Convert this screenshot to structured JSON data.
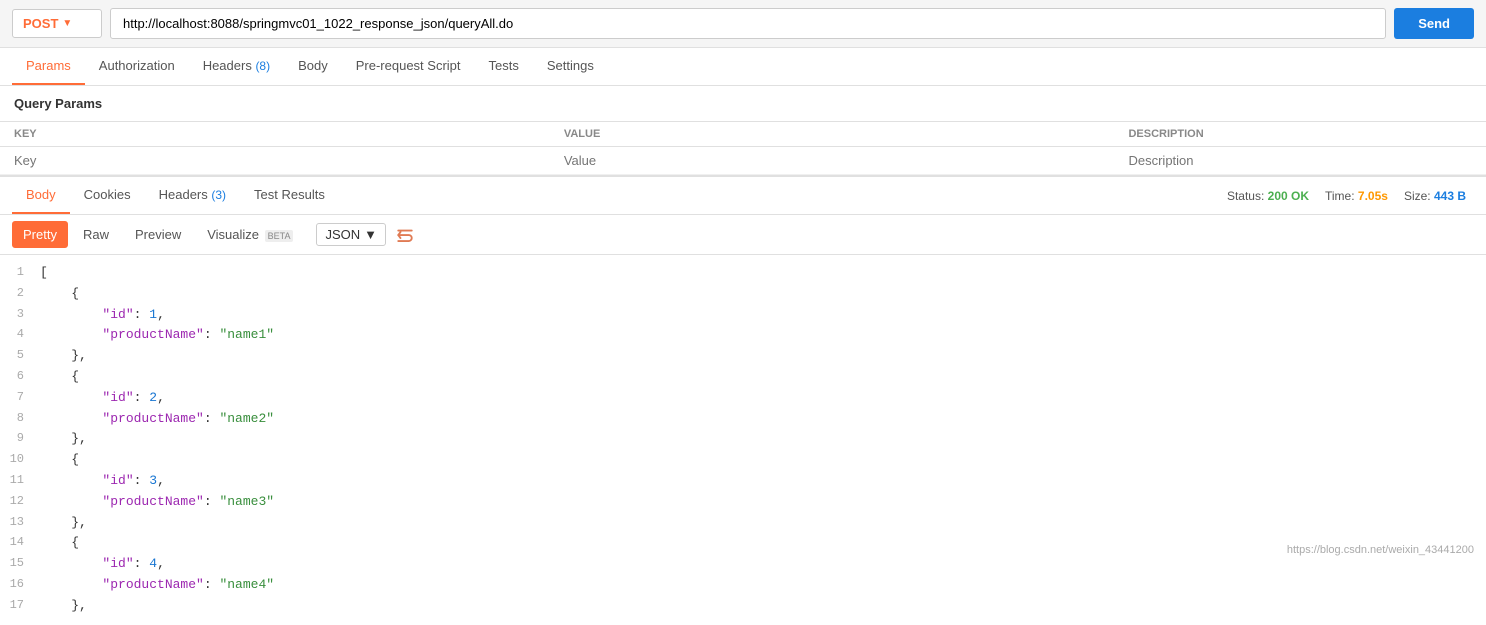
{
  "urlBar": {
    "method": "POST",
    "url": "http://localhost:8088/springmvc01_1022_response_json/queryAll.do",
    "sendLabel": "Send"
  },
  "requestTabs": [
    {
      "id": "params",
      "label": "Params",
      "badge": null,
      "active": true
    },
    {
      "id": "authorization",
      "label": "Authorization",
      "badge": null,
      "active": false
    },
    {
      "id": "headers",
      "label": "Headers",
      "badge": "8",
      "active": false
    },
    {
      "id": "body",
      "label": "Body",
      "badge": null,
      "active": false
    },
    {
      "id": "prerequest",
      "label": "Pre-request Script",
      "badge": null,
      "active": false
    },
    {
      "id": "tests",
      "label": "Tests",
      "badge": null,
      "active": false
    },
    {
      "id": "settings",
      "label": "Settings",
      "badge": null,
      "active": false
    }
  ],
  "queryParams": {
    "title": "Query Params",
    "columns": [
      "KEY",
      "VALUE",
      "DESCRIPTION"
    ],
    "keyPlaceholder": "Key",
    "valuePlaceholder": "Value",
    "descPlaceholder": "Description"
  },
  "responseTabs": [
    {
      "id": "body",
      "label": "Body",
      "active": true
    },
    {
      "id": "cookies",
      "label": "Cookies",
      "active": false
    },
    {
      "id": "headers",
      "label": "Headers",
      "badge": "3",
      "active": false
    },
    {
      "id": "testresults",
      "label": "Test Results",
      "active": false
    }
  ],
  "responseStatus": {
    "statusLabel": "Status:",
    "statusValue": "200 OK",
    "timeLabel": "Time:",
    "timeValue": "7.05s",
    "sizeLabel": "Size:",
    "sizeValue": "443 B"
  },
  "responseToolbar": {
    "tabs": [
      "Pretty",
      "Raw",
      "Preview",
      "Visualize"
    ],
    "activeTab": "Pretty",
    "betaLabel": "BETA",
    "format": "JSON"
  },
  "codeLines": [
    {
      "num": 1,
      "content": "["
    },
    {
      "num": 2,
      "content": "    {"
    },
    {
      "num": 3,
      "content": "        \"id\": 1,"
    },
    {
      "num": 4,
      "content": "        \"productName\": \"name1\""
    },
    {
      "num": 5,
      "content": "    },"
    },
    {
      "num": 6,
      "content": "    {"
    },
    {
      "num": 7,
      "content": "        \"id\": 2,"
    },
    {
      "num": 8,
      "content": "        \"productName\": \"name2\""
    },
    {
      "num": 9,
      "content": "    },"
    },
    {
      "num": 10,
      "content": "    {"
    },
    {
      "num": 11,
      "content": "        \"id\": 3,"
    },
    {
      "num": 12,
      "content": "        \"productName\": \"name3\""
    },
    {
      "num": 13,
      "content": "    },"
    },
    {
      "num": 14,
      "content": "    {"
    },
    {
      "num": 15,
      "content": "        \"id\": 4,"
    },
    {
      "num": 16,
      "content": "        \"productName\": \"name4\""
    },
    {
      "num": 17,
      "content": "    },"
    }
  ],
  "watermark": "https://blog.csdn.net/weixin_43441200"
}
